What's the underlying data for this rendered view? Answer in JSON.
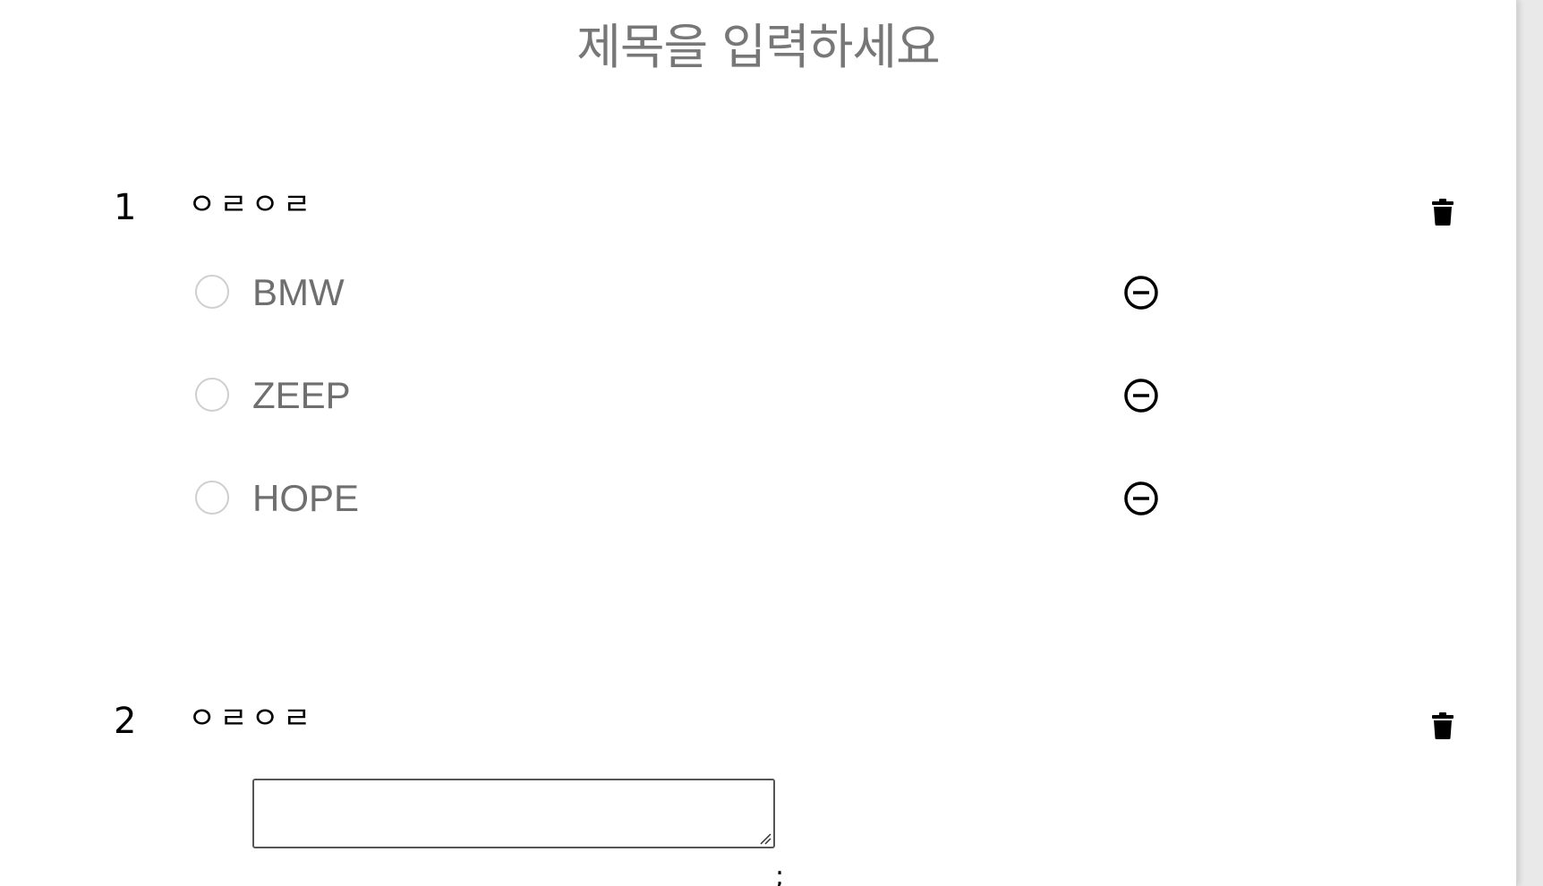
{
  "page": {
    "title": "제목을 입력하세요"
  },
  "questions": [
    {
      "number": "1",
      "title": "ㅇㄹㅇㄹ",
      "delete_icon": "trash-icon",
      "options": [
        {
          "label": "BMW",
          "remove_icon": "minus-circle-icon"
        },
        {
          "label": "ZEEP",
          "remove_icon": "minus-circle-icon"
        },
        {
          "label": "HOPE",
          "remove_icon": "minus-circle-icon"
        }
      ]
    },
    {
      "number": "2",
      "title": "ㅇㄹㅇㄹ",
      "delete_icon": "trash-icon",
      "answer_value": "",
      "answer_placeholder": "",
      "below_text": ";"
    }
  ],
  "colors": {
    "title": "#777777",
    "option_text": "#6f6f6f",
    "radio_border": "#cfcfcf",
    "icon": "#000000"
  }
}
